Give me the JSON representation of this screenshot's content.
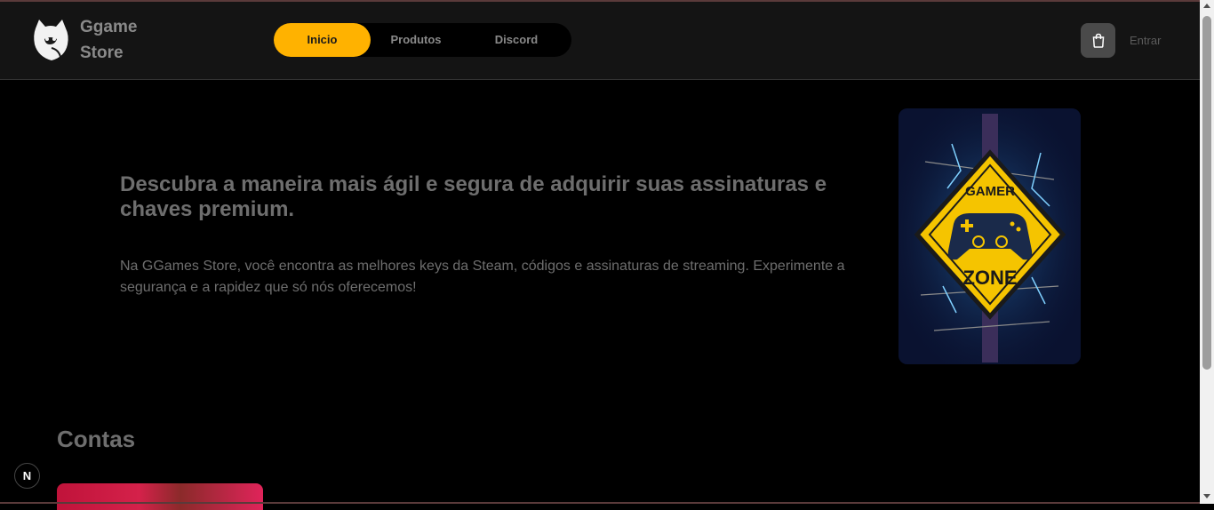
{
  "brand": {
    "line1": "Ggame",
    "line2": "Store",
    "logo_icon": "cat-logo-icon"
  },
  "nav": {
    "items": [
      {
        "label": "Inicio",
        "active": true
      },
      {
        "label": "Produtos",
        "active": false
      },
      {
        "label": "Discord",
        "active": false
      }
    ],
    "active_color": "#ffb200"
  },
  "header_right": {
    "cart_icon": "shopping-bag-icon",
    "login_label": "Entrar"
  },
  "hero": {
    "title": "Descubra a maneira mais ágil e segura de adquirir suas assinaturas e chaves premium.",
    "text": "Na GGames Store, você encontra as melhores keys da Steam, códigos e assinaturas de streaming. Experimente a segurança e a rapidez que só nós oferecemos!",
    "image_text_top": "GAMER",
    "image_text_bottom": "ZONE"
  },
  "sections": {
    "accounts_title": "Contas"
  },
  "next_badge": {
    "label": "N"
  }
}
